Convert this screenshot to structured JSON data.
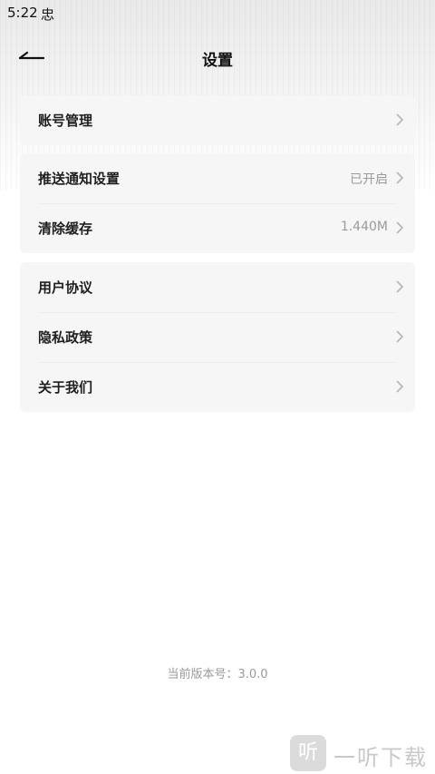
{
  "status_bar": {
    "time": "5:22",
    "notification_icon_glyph": "忠"
  },
  "nav": {
    "back_icon": "back-arrow-icon",
    "title": "设置"
  },
  "sections": [
    {
      "items": [
        {
          "label": "账号管理",
          "value": ""
        }
      ]
    },
    {
      "items": [
        {
          "label": "推送通知设置",
          "value": "已开启"
        },
        {
          "label": "清除缓存",
          "value": "1.440M"
        }
      ]
    },
    {
      "items": [
        {
          "label": "用户协议",
          "value": ""
        },
        {
          "label": "隐私政策",
          "value": ""
        },
        {
          "label": "关于我们",
          "value": ""
        }
      ]
    }
  ],
  "footer": {
    "version_text": "当前版本号：3.0.0"
  },
  "watermark": {
    "badge": "听",
    "text": "一听下载"
  },
  "colors": {
    "card_background": "#f6f6f6",
    "label": "#1f1f1f",
    "muted": "#9a9a9a"
  }
}
